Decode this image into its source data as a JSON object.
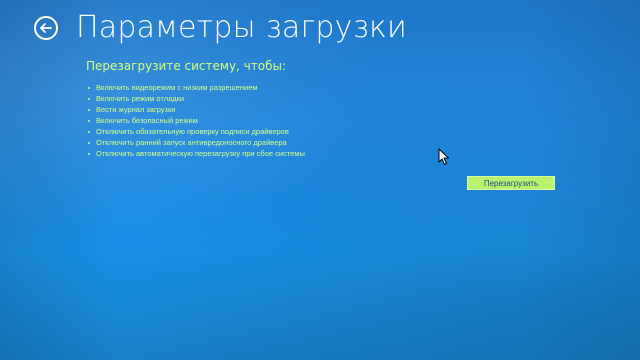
{
  "header": {
    "back_icon": "back-arrow-icon",
    "title": "Параметры загрузки"
  },
  "content": {
    "subtitle": "Перезагрузите систему, чтобы:",
    "options": [
      "Включить видеорежим с низким разрешением",
      "Включить режим отладки",
      "Вести журнал загрузки",
      "Включить безопасный режим",
      "Отключить обязательную проверку подписи драйверов",
      "Отключить ранний запуск антивредоносного драйвера",
      "Отключить автоматическую перезагрузку при сбое системы"
    ]
  },
  "actions": {
    "restart_label": "Перезагрузить"
  },
  "colors": {
    "background": "#1f86de",
    "accent_text": "#d5ff83",
    "button_bg": "#b9f26c"
  },
  "cursor": {
    "icon": "mouse-pointer-icon"
  }
}
